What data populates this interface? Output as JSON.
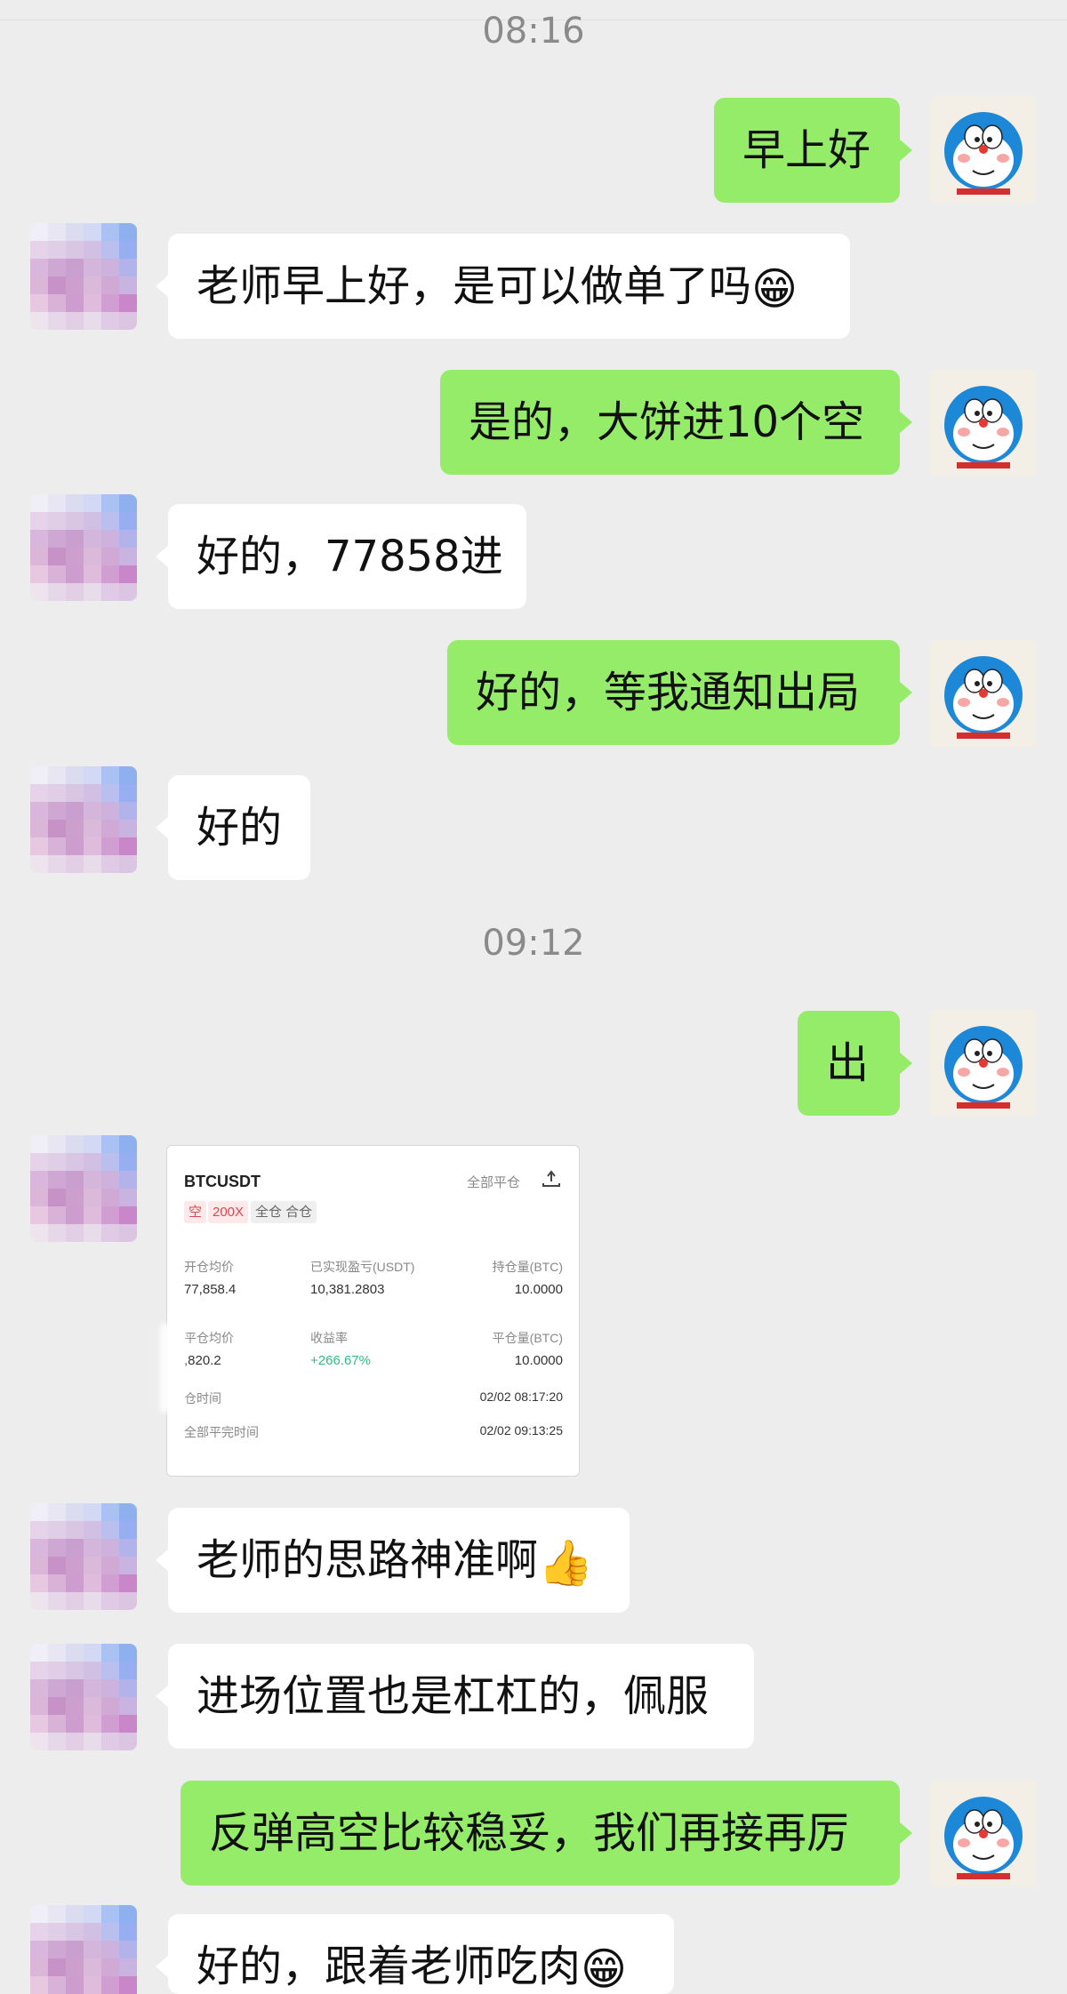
{
  "timestamps": [
    "08:16",
    "09:12"
  ],
  "messages": [
    {
      "side": "out",
      "text": "早上好"
    },
    {
      "side": "in",
      "text": "老师早上好，是可以做单了吗",
      "emoji": "😁"
    },
    {
      "side": "out",
      "text": "是的，大饼进10个空"
    },
    {
      "side": "in",
      "text": "好的，77858进"
    },
    {
      "side": "out",
      "text": "好的，等我通知出局"
    },
    {
      "side": "in",
      "text": "好的"
    },
    {
      "side": "out",
      "text": "出"
    },
    {
      "side": "in",
      "text": "老师的思路神准啊",
      "emoji": "👍"
    },
    {
      "side": "in",
      "text": "进场位置也是杠杠的，佩服"
    },
    {
      "side": "out",
      "text": "反弹高空比较稳妥，我们再接再厉"
    },
    {
      "side": "in",
      "text": "好的，跟着老师吃肉",
      "emoji": "😁"
    }
  ],
  "trade_card": {
    "symbol": "BTCUSDT",
    "close_all": "全部平仓",
    "share_icon": "share-icon",
    "direction": "空",
    "leverage": "200X",
    "margin_mode": "全仓 合仓",
    "open_avg_label": "开仓均价",
    "open_avg_value": "77,858.4",
    "realized_pnl_label": "已实现盈亏(USDT)",
    "realized_pnl_value": "10,381.2803",
    "position_label": "持仓量(BTC)",
    "position_value": "10.0000",
    "close_avg_label": "平仓均价",
    "close_avg_value": ",820.2",
    "roi_label": "收益率",
    "roi_value": "+266.67%",
    "closed_qty_label": "平仓量(BTC)",
    "closed_qty_value": "10.0000",
    "open_time_label": "仓时间",
    "open_time_value": "02/02 08:17:20",
    "close_time_label": "全部平完时间",
    "close_time_value": "02/02 09:13:25"
  },
  "colors": {
    "background": "#ededed",
    "outgoing_bubble": "#95ec69",
    "incoming_bubble": "#ffffff",
    "timestamp": "#8a8a8a",
    "profit_green": "#2ebd85",
    "short_red": "#e0464e"
  }
}
